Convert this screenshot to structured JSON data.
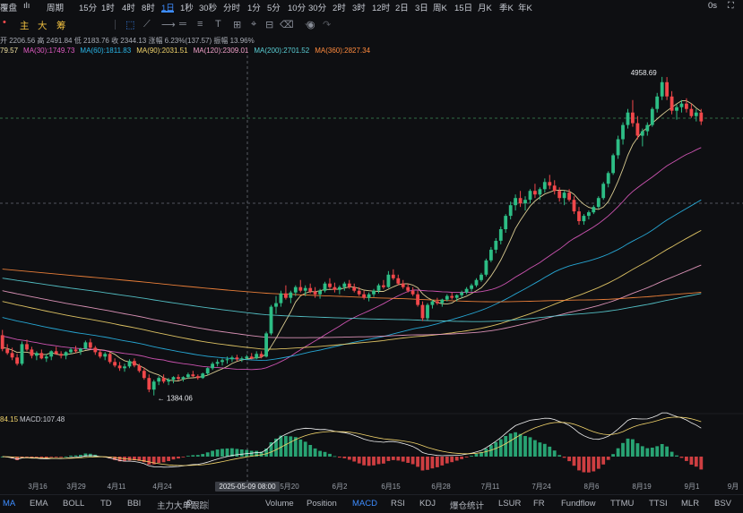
{
  "toolbar": {
    "items": [
      "覆盘",
      "ılı",
      "周期",
      "15分",
      "1时",
      "4时",
      "8时",
      "1日",
      "1秒",
      "30秒",
      "分时",
      "1分",
      "5分",
      "10分",
      "30分",
      "2时",
      "3时",
      "12时",
      "2日",
      "3日",
      "周K",
      "15日",
      "月K",
      "季K",
      "年K"
    ],
    "active_index": 7,
    "right": [
      "0s",
      "⛶"
    ]
  },
  "toolbar2": {
    "labels": [
      "主",
      "大",
      "筹"
    ],
    "icons": [
      "select-icon",
      "line-icon",
      "ray-icon",
      "hline-icon",
      "fib-icon",
      "text-icon",
      "measure-icon",
      "magnet-icon",
      "lock-icon",
      "eye-icon",
      "trash-icon",
      "undo-icon",
      "redo-icon"
    ]
  },
  "info_row1": "开 2206.56  高 2491.84  低 2183.76  收 2344.13  涨幅 6.23%(137.57)  振幅 13.96%",
  "info_row2": [
    {
      "text": "79.57",
      "color": "#f0e0a0"
    },
    {
      "text": "MA(30):1749.73",
      "color": "#e15bc2"
    },
    {
      "text": "MA(60):1811.83",
      "color": "#29b6e8"
    },
    {
      "text": "MA(90):2031.51",
      "color": "#f2d46b"
    },
    {
      "text": "MA(120):2309.01",
      "color": "#f0a0c8"
    },
    {
      "text": "MA(200):2701.52",
      "color": "#5ad0d6"
    },
    {
      "text": "MA(360):2827.34",
      "color": "#ff8a3d"
    }
  ],
  "macd_label": {
    "left": "84.15",
    "macd": "MACD:107.48"
  },
  "chart_data": {
    "type": "candlestick",
    "title": "",
    "xlabel": "",
    "ylabel": "",
    "x_ticks": [
      "3月16",
      "3月29",
      "4月11",
      "4月24",
      "5月20",
      "6月2",
      "6月15",
      "6月28",
      "7月11",
      "7月24",
      "8月6",
      "8月19",
      "9月1",
      "9月"
    ],
    "crosshair_label": "2025-05-09 08:00",
    "annotations": [
      {
        "text": "4958.69",
        "type": "high"
      },
      {
        "text": "← 1384.06",
        "type": "low"
      }
    ],
    "ylim": [
      1200,
      5200
    ],
    "macd_ylim": [
      -400,
      400
    ],
    "candles": [
      [
        2060,
        2120,
        1880,
        1905
      ],
      [
        1905,
        1960,
        1840,
        1860
      ],
      [
        1860,
        1920,
        1780,
        1810
      ],
      [
        1810,
        1850,
        1720,
        1740
      ],
      [
        1740,
        1990,
        1720,
        1960
      ],
      [
        1960,
        2010,
        1880,
        1900
      ],
      [
        1900,
        1930,
        1800,
        1830
      ],
      [
        1830,
        1880,
        1780,
        1860
      ],
      [
        1860,
        1900,
        1790,
        1800
      ],
      [
        1800,
        1850,
        1760,
        1820
      ],
      [
        1820,
        1890,
        1780,
        1880
      ],
      [
        1880,
        1930,
        1840,
        1850
      ],
      [
        1850,
        1880,
        1800,
        1830
      ],
      [
        1830,
        1880,
        1790,
        1870
      ],
      [
        1870,
        1920,
        1850,
        1900
      ],
      [
        1900,
        1940,
        1860,
        1880
      ],
      [
        1880,
        1920,
        1840,
        1910
      ],
      [
        1910,
        2000,
        1900,
        1980
      ],
      [
        1980,
        2020,
        1900,
        1920
      ],
      [
        1920,
        1940,
        1840,
        1870
      ],
      [
        1870,
        1900,
        1800,
        1820
      ],
      [
        1820,
        1870,
        1780,
        1850
      ],
      [
        1850,
        1870,
        1740,
        1760
      ],
      [
        1760,
        1800,
        1700,
        1720
      ],
      [
        1720,
        1760,
        1660,
        1690
      ],
      [
        1690,
        1740,
        1650,
        1710
      ],
      [
        1710,
        1790,
        1690,
        1770
      ],
      [
        1770,
        1800,
        1700,
        1720
      ],
      [
        1720,
        1740,
        1640,
        1660
      ],
      [
        1660,
        1700,
        1560,
        1580
      ],
      [
        1580,
        1620,
        1420,
        1450
      ],
      [
        1450,
        1560,
        1384,
        1540
      ],
      [
        1540,
        1600,
        1500,
        1580
      ],
      [
        1580,
        1620,
        1520,
        1540
      ],
      [
        1540,
        1580,
        1500,
        1560
      ],
      [
        1560,
        1600,
        1520,
        1590
      ],
      [
        1590,
        1620,
        1550,
        1570
      ],
      [
        1570,
        1600,
        1540,
        1590
      ],
      [
        1590,
        1640,
        1570,
        1620
      ],
      [
        1620,
        1660,
        1590,
        1600
      ],
      [
        1600,
        1620,
        1560,
        1580
      ],
      [
        1580,
        1640,
        1570,
        1630
      ],
      [
        1630,
        1700,
        1610,
        1690
      ],
      [
        1690,
        1760,
        1670,
        1740
      ],
      [
        1740,
        1790,
        1710,
        1760
      ],
      [
        1760,
        1800,
        1720,
        1780
      ],
      [
        1780,
        1820,
        1740,
        1790
      ],
      [
        1790,
        1830,
        1760,
        1810
      ],
      [
        1810,
        1840,
        1770,
        1790
      ],
      [
        1790,
        1820,
        1760,
        1800
      ],
      [
        1800,
        1840,
        1780,
        1820
      ],
      [
        1820,
        1860,
        1790,
        1800
      ],
      [
        1800,
        1880,
        1790,
        1850
      ],
      [
        1850,
        1880,
        1800,
        1820
      ],
      [
        1820,
        2100,
        1810,
        2080
      ],
      [
        2080,
        2400,
        2060,
        2380
      ],
      [
        2380,
        2500,
        2300,
        2420
      ],
      [
        2420,
        2560,
        2380,
        2530
      ],
      [
        2530,
        2620,
        2460,
        2480
      ],
      [
        2480,
        2560,
        2420,
        2540
      ],
      [
        2540,
        2620,
        2500,
        2600
      ],
      [
        2600,
        2680,
        2540,
        2560
      ],
      [
        2560,
        2620,
        2500,
        2590
      ],
      [
        2590,
        2640,
        2530,
        2550
      ],
      [
        2550,
        2600,
        2480,
        2520
      ],
      [
        2520,
        2580,
        2470,
        2560
      ],
      [
        2560,
        2660,
        2540,
        2640
      ],
      [
        2640,
        2700,
        2580,
        2600
      ],
      [
        2600,
        2650,
        2540,
        2570
      ],
      [
        2570,
        2620,
        2520,
        2600
      ],
      [
        2600,
        2660,
        2560,
        2640
      ],
      [
        2640,
        2680,
        2580,
        2600
      ],
      [
        2600,
        2640,
        2540,
        2560
      ],
      [
        2560,
        2600,
        2500,
        2520
      ],
      [
        2520,
        2560,
        2460,
        2480
      ],
      [
        2480,
        2540,
        2440,
        2520
      ],
      [
        2520,
        2580,
        2490,
        2560
      ],
      [
        2560,
        2640,
        2530,
        2620
      ],
      [
        2620,
        2680,
        2580,
        2600
      ],
      [
        2600,
        2780,
        2590,
        2740
      ],
      [
        2740,
        2800,
        2680,
        2700
      ],
      [
        2700,
        2740,
        2620,
        2640
      ],
      [
        2640,
        2680,
        2580,
        2600
      ],
      [
        2600,
        2640,
        2540,
        2560
      ],
      [
        2560,
        2600,
        2500,
        2520
      ],
      [
        2520,
        2560,
        2380,
        2400
      ],
      [
        2400,
        2440,
        2220,
        2250
      ],
      [
        2250,
        2420,
        2230,
        2400
      ],
      [
        2400,
        2460,
        2360,
        2440
      ],
      [
        2440,
        2480,
        2400,
        2420
      ],
      [
        2420,
        2470,
        2380,
        2460
      ],
      [
        2460,
        2520,
        2440,
        2500
      ],
      [
        2500,
        2540,
        2460,
        2480
      ],
      [
        2480,
        2520,
        2440,
        2510
      ],
      [
        2510,
        2560,
        2480,
        2540
      ],
      [
        2540,
        2600,
        2520,
        2580
      ],
      [
        2580,
        2640,
        2550,
        2620
      ],
      [
        2620,
        2700,
        2600,
        2680
      ],
      [
        2680,
        2760,
        2660,
        2740
      ],
      [
        2740,
        2920,
        2720,
        2900
      ],
      [
        2900,
        3050,
        2880,
        3020
      ],
      [
        3020,
        3150,
        2980,
        3120
      ],
      [
        3120,
        3280,
        3080,
        3250
      ],
      [
        3250,
        3420,
        3210,
        3400
      ],
      [
        3400,
        3560,
        3360,
        3520
      ],
      [
        3520,
        3640,
        3460,
        3600
      ],
      [
        3600,
        3680,
        3500,
        3540
      ],
      [
        3540,
        3620,
        3460,
        3580
      ],
      [
        3580,
        3700,
        3540,
        3680
      ],
      [
        3680,
        3760,
        3600,
        3640
      ],
      [
        3640,
        3720,
        3580,
        3700
      ],
      [
        3700,
        3820,
        3660,
        3780
      ],
      [
        3780,
        3860,
        3700,
        3740
      ],
      [
        3740,
        3800,
        3640,
        3680
      ],
      [
        3680,
        3720,
        3560,
        3600
      ],
      [
        3600,
        3680,
        3520,
        3660
      ],
      [
        3660,
        3700,
        3560,
        3580
      ],
      [
        3580,
        3620,
        3420,
        3450
      ],
      [
        3450,
        3500,
        3300,
        3340
      ],
      [
        3340,
        3420,
        3300,
        3400
      ],
      [
        3400,
        3460,
        3360,
        3440
      ],
      [
        3440,
        3520,
        3420,
        3500
      ],
      [
        3500,
        3620,
        3480,
        3600
      ],
      [
        3600,
        3780,
        3580,
        3760
      ],
      [
        3760,
        3900,
        3720,
        3880
      ],
      [
        3880,
        4100,
        3860,
        4080
      ],
      [
        4080,
        4300,
        4040,
        4260
      ],
      [
        4260,
        4450,
        4200,
        4420
      ],
      [
        4420,
        4600,
        4380,
        4560
      ],
      [
        4560,
        4700,
        4400,
        4440
      ],
      [
        4440,
        4520,
        4260,
        4300
      ],
      [
        4300,
        4380,
        4180,
        4350
      ],
      [
        4350,
        4450,
        4300,
        4420
      ],
      [
        4420,
        4620,
        4400,
        4600
      ],
      [
        4600,
        4780,
        4560,
        4740
      ],
      [
        4740,
        4960,
        4700,
        4900
      ],
      [
        4900,
        4958,
        4700,
        4740
      ],
      [
        4740,
        4800,
        4540,
        4580
      ],
      [
        4580,
        4650,
        4480,
        4620
      ],
      [
        4620,
        4700,
        4560,
        4660
      ],
      [
        4660,
        4720,
        4560,
        4600
      ],
      [
        4600,
        4660,
        4500,
        4520
      ],
      [
        4520,
        4600,
        4460,
        4560
      ],
      [
        4560,
        4600,
        4420,
        4460
      ]
    ]
  }
}
